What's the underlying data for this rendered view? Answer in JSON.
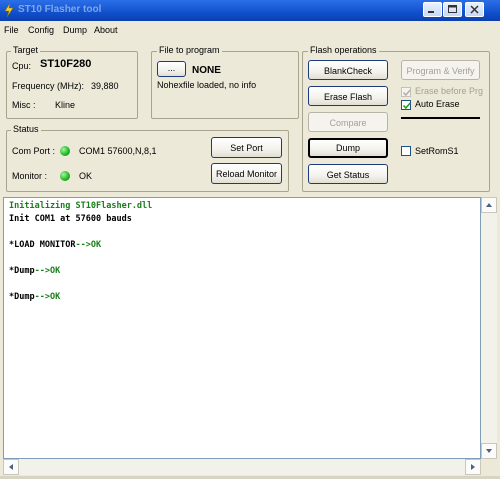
{
  "window": {
    "title": "ST10 Flasher tool"
  },
  "menu": [
    "File",
    "Config",
    "Dump",
    "About"
  ],
  "target": {
    "group_label": "Target",
    "cpu_label": "Cpu:",
    "cpu_value": "ST10F280",
    "freq_label": "Frequency (MHz):",
    "freq_value": "39,880",
    "misc_label": "Misc :",
    "misc_value": "Kline"
  },
  "file_program": {
    "group_label": "File to program",
    "browse_label": "...",
    "file_name": "NONE",
    "info": "Nohexfile loaded, no info"
  },
  "flash_ops": {
    "group_label": "Flash operations",
    "blank_check": "BlankCheck",
    "erase_flash": "Erase Flash",
    "compare": "Compare",
    "dump": "Dump",
    "get_status": "Get Status",
    "program_verify": "Program & Verify",
    "erase_before_prg": "Erase before Prg",
    "auto_erase": "Auto Erase",
    "set_rom_s1": "SetRomS1",
    "erase_before_prg_checked": true,
    "auto_erase_checked": true,
    "set_rom_s1_checked": false
  },
  "status": {
    "group_label": "Status",
    "com_port_label": "Com Port :",
    "com_port_value": "COM1 57600,N,8,1",
    "monitor_label": "Monitor :",
    "monitor_value": "OK",
    "set_port": "Set Port",
    "reload_monitor": "Reload Monitor",
    "com_led_color": "#1db41d",
    "monitor_led_color": "#1db41d"
  },
  "log": [
    {
      "parts": [
        {
          "text": "Initializing ST10Flasher.dll",
          "color": "green"
        }
      ]
    },
    {
      "parts": [
        {
          "text": "Init COM1 at 57600 bauds",
          "color": "black"
        }
      ]
    },
    {
      "parts": [
        {
          "text": "*LOAD MONITOR",
          "color": "black"
        },
        {
          "text": "-->OK",
          "color": "green"
        }
      ]
    },
    {
      "parts": [
        {
          "text": "*Dump",
          "color": "black"
        },
        {
          "text": "-->OK",
          "color": "green"
        }
      ]
    },
    {
      "parts": [
        {
          "text": "*Dump",
          "color": "black"
        },
        {
          "text": "-->OK",
          "color": "green"
        }
      ]
    }
  ]
}
